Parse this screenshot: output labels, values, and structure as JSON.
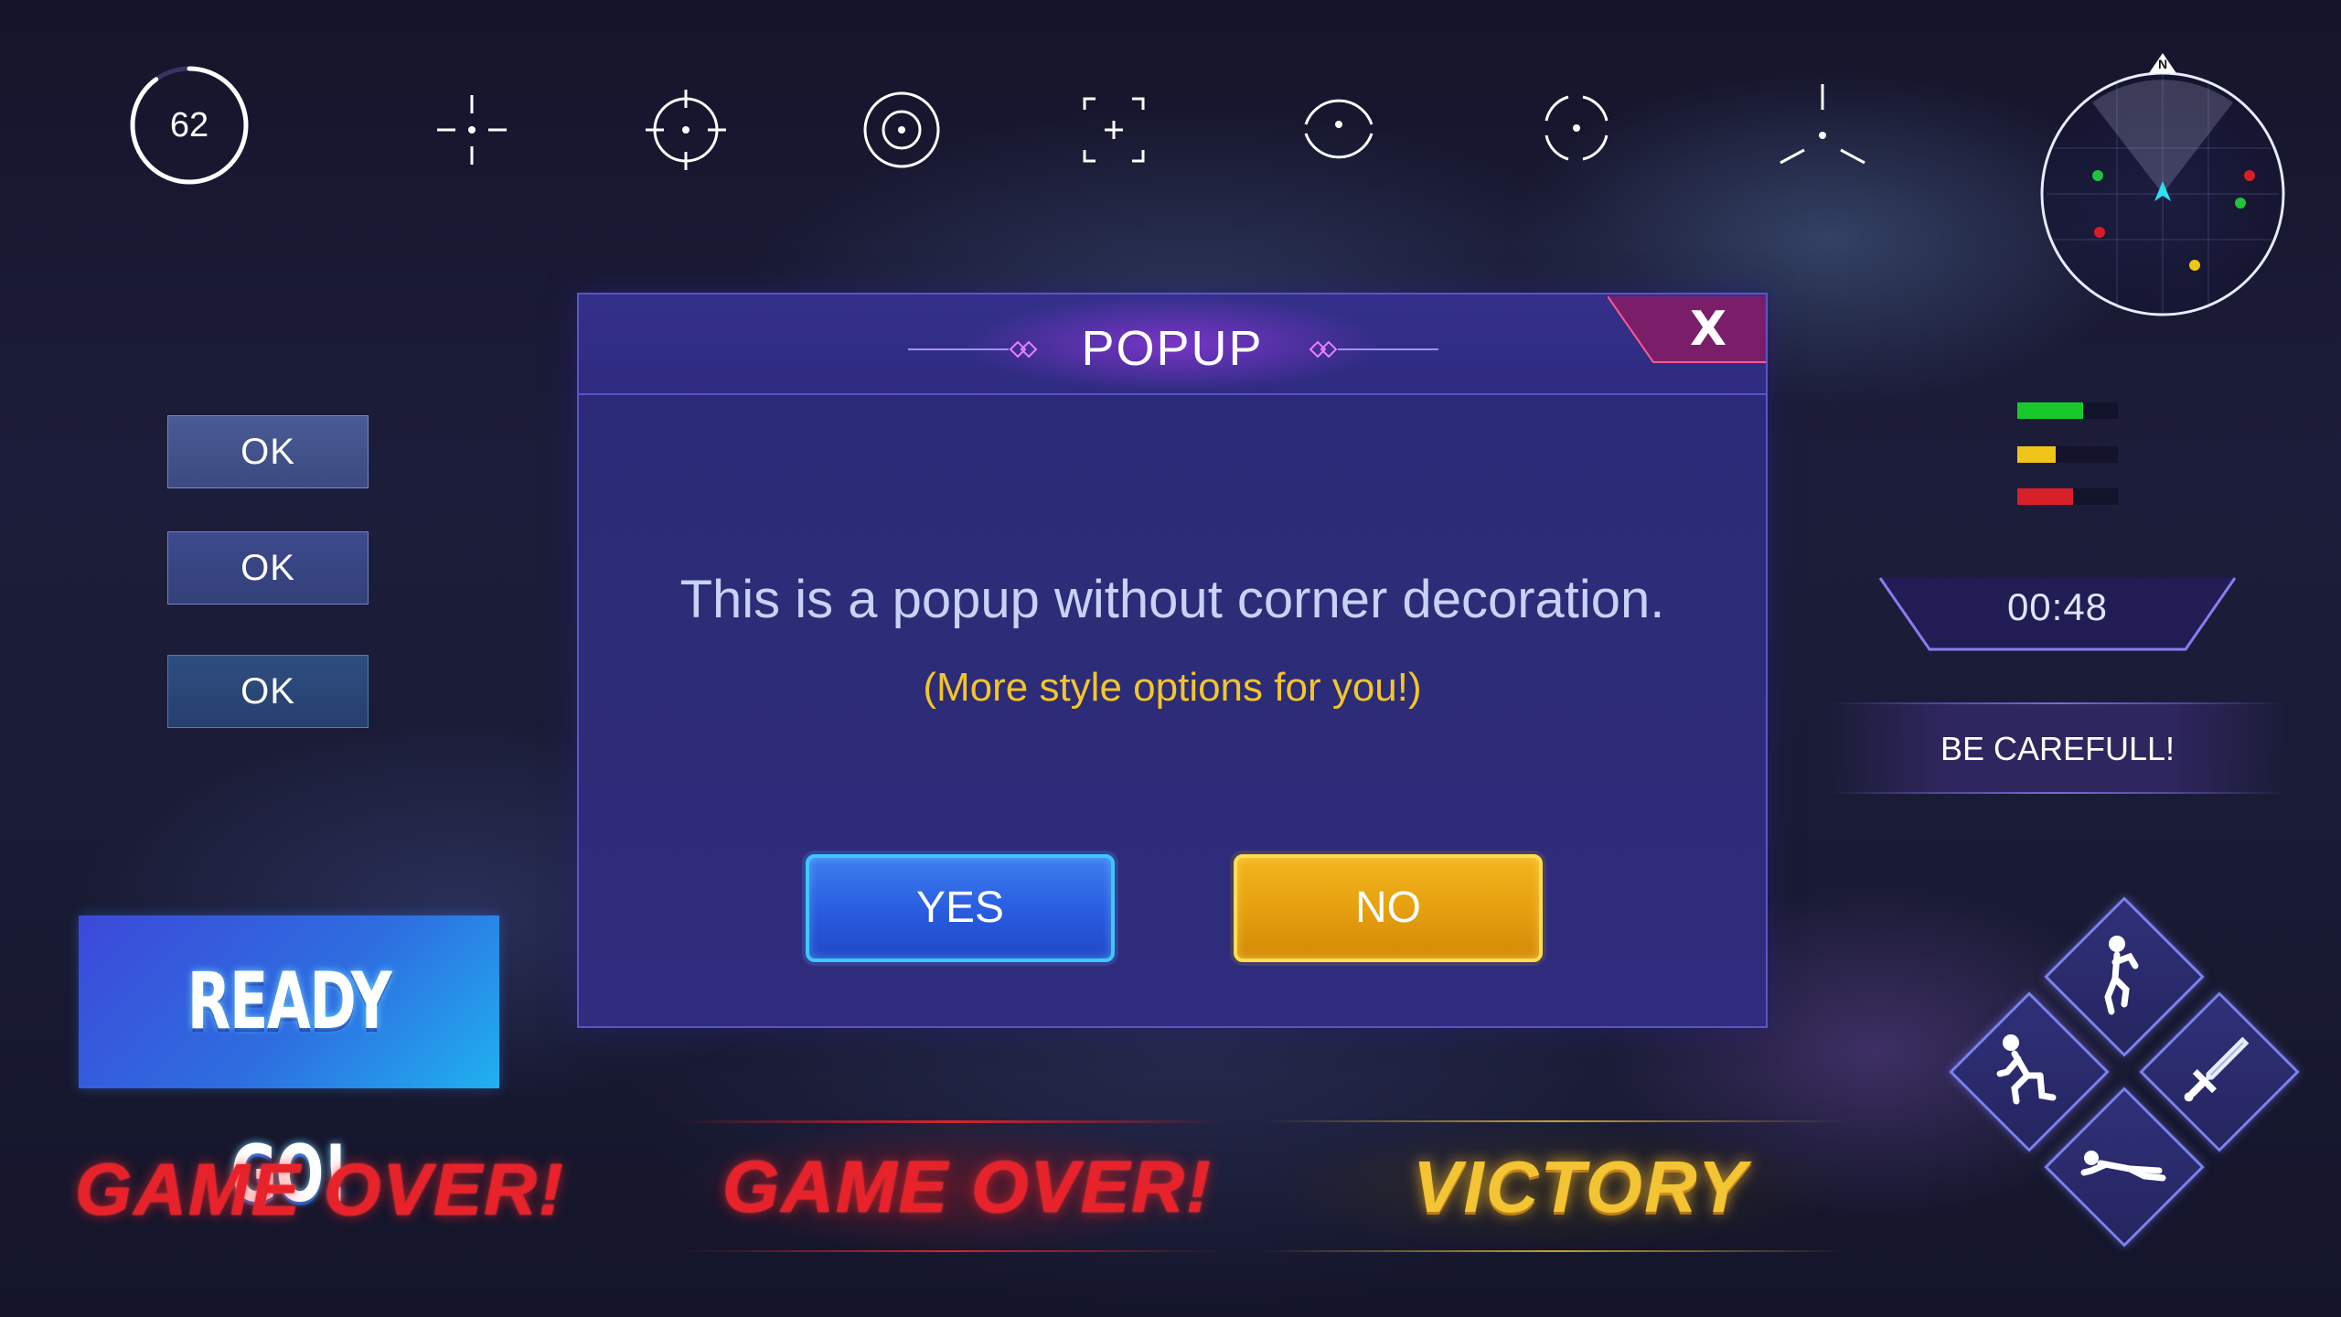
{
  "hud": {
    "timer_ring": {
      "value": "62",
      "progress": 0.9
    },
    "crosshairs": [
      {
        "icon": "dot-crosshair-icon"
      },
      {
        "icon": "circle-crosshair-icon"
      },
      {
        "icon": "ring-dot-crosshair-icon"
      },
      {
        "icon": "bracket-crosshair-icon"
      },
      {
        "icon": "split-circle-crosshair-icon"
      },
      {
        "icon": "quad-arc-crosshair-icon"
      },
      {
        "icon": "tri-line-crosshair-icon"
      }
    ],
    "radar": {
      "north_label": "N"
    },
    "status_bars": [
      {
        "color": "#19c92c",
        "level": 0.65
      },
      {
        "color": "#f0c418",
        "level": 0.38
      },
      {
        "color": "#d8202a",
        "level": 0.55
      }
    ],
    "countdown": "00:48",
    "warning": "BE CAREFULL!"
  },
  "left_buttons": [
    {
      "label": "OK"
    },
    {
      "label": "OK"
    },
    {
      "label": "OK"
    }
  ],
  "banners": {
    "ready": "READY GO!",
    "game_over_1": "GAME OVER!",
    "game_over_2": "GAME OVER!",
    "victory": "VICTORY"
  },
  "popup": {
    "title": "POPUP",
    "close": "X",
    "message": "This is a popup without corner decoration.",
    "sub_message": "(More style options for you!)",
    "yes": "YES",
    "no": "NO"
  },
  "actions": [
    {
      "icon": "jump-icon"
    },
    {
      "icon": "crouch-icon"
    },
    {
      "icon": "sword-icon"
    },
    {
      "icon": "prone-icon"
    }
  ],
  "colors": {
    "accent_blue": "#2a5ee0",
    "accent_gold": "#f2b61e",
    "danger_red": "#e8222a",
    "popup_bg": "#2d2c77"
  }
}
